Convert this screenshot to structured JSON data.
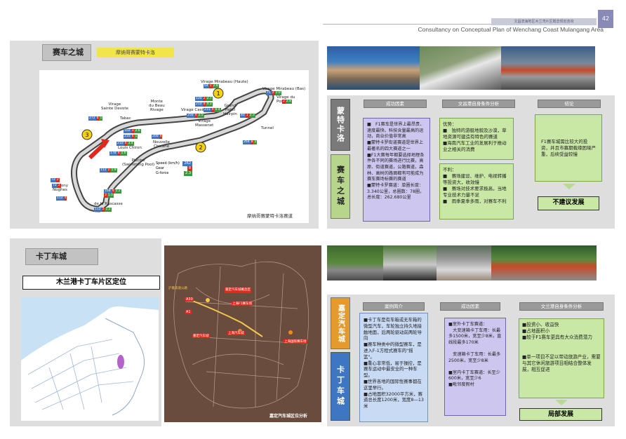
{
  "header": {
    "page_number": "42",
    "small_strip": "文昌滨海地区木兰湾片区概念规划咨询",
    "subtitle": "Consultancy on Conceptual Plan of Wenchang Coast Mulangang Area"
  },
  "section1": {
    "title": "赛车之城",
    "tag": "摩纳哥赛蒙特卡洛",
    "map_caption": "摩纳哥赛蒙特卡洛赛道",
    "track_labels": {
      "mirabeau_haute": "Virage Mirabeau (Haute)",
      "mirabeau_bas": "Virage Mirabeau (Bas)",
      "portier": "Virage du Portier",
      "sainte_devote": "Virage\nSainte Devote",
      "beau_rivage": "Monte\ndu Beau\nRivage",
      "casino": "Virage Casino",
      "grand_hotel": "Grand\nHotel\nHairpin",
      "massenet": "Virage\nMassenet",
      "tabac": "Tabac",
      "louis_chiron": "Louis Chiron",
      "nouvelle_chicane": "Nouvelle\nChicane",
      "tunnel": "Tunnel",
      "piscine": "Piscine\n(Swimming Pool)",
      "anthony_noghes": "Anthony\nNoghes",
      "rascasse": "de la Rascasse"
    },
    "legend": {
      "speed_label": "Speed (km/h)",
      "speed_val": "262",
      "gear_label": "Gear",
      "gear_val": "8",
      "gforce_label": "G-force",
      "gforce_val": "2.3"
    },
    "track_data": [
      {
        "s": "64",
        "g": "1",
        "f": "2.8"
      },
      {
        "s": "71",
        "g": "2",
        "f": "2.0"
      },
      {
        "s": "",
        "g": "2",
        "f": "2.8"
      },
      {
        "s": "120",
        "g": "2",
        "f": "2.7"
      },
      {
        "s": "210",
        "g": "4",
        "f": "4.3"
      },
      {
        "s": "215",
        "g": "4",
        "f": "0.4"
      },
      {
        "s": "256",
        "g": "4",
        "f": "2.5"
      },
      {
        "s": "40",
        "g": "1",
        "f": "2.3"
      },
      {
        "s": "272",
        "g": "6",
        "f": "1"
      },
      {
        "s": "102",
        "g": "3",
        "f": "2.6"
      },
      {
        "s": "210",
        "g": "4",
        "f": "1"
      },
      {
        "s": "264",
        "g": "8",
        "f": "2"
      },
      {
        "s": "210",
        "g": "4",
        "f": "3.4"
      },
      {
        "s": "178",
        "g": "4",
        "f": "1.6"
      },
      {
        "s": "200",
        "g": "4",
        "f": ""
      },
      {
        "s": "112",
        "g": "2",
        "f": "1.9"
      },
      {
        "s": "72",
        "g": "2",
        "f": ""
      },
      {
        "s": "72",
        "g": "2",
        "f": ""
      },
      {
        "s": "168",
        "g": "4",
        "f": "1.2"
      },
      {
        "s": "",
        "g": "3",
        "f": "1.0"
      },
      {
        "s": "112",
        "g": "4",
        "f": ""
      },
      {
        "s": "112",
        "g": "2",
        "f": "1.2"
      }
    ],
    "side_tabs": [
      "蒙特卡洛",
      "赛车之城"
    ],
    "col_heads": [
      "成功因素",
      "文昌港自身条件分析",
      "结论"
    ],
    "success_text": "■　F1赛车是世界上最昂贵、速度最快、科技含量最高的运动，商业价值非常高\n■蒙特卡罗街道赛道是世界上最著名的四大赛道之一\n■F1大赛每年都要选择地理条件各不同的赛场进行比赛，高原、街道赛道，公路赛道，森林、高树的路面都有可能成为赛车赛场标赛的赛道\n■蒙特卡罗赛道：单圈长度：3.340公里，总圈数：78圈，总长度：262.680公里",
    "adv_text": "优势：\n■　独特的游艇地貌及沙漠，草地资源可建造有特色的赛道\n■海南汽车工业的发展利于推动业之相关的消费",
    "disadv_text": "不利：\n■　赛场建设、维护、电视转播等投资大，收效慢\n■　赛场对技术要求极高，当地专业技术力量不足\n■　雨季夏季多雨，对赛车不利",
    "conclusion_text": "F1赛车城需比较大的投资，并且市募期载缘困境严重，后续受益较慢",
    "result": "不建议发展"
  },
  "section2": {
    "title": "卡丁车城",
    "location_title": "木兰港卡丁车片区定位",
    "map_caption": "嘉定汽车城区位分析",
    "map_labels": [
      "沪嘉高速公路",
      "A30",
      "A1",
      "嘉定汽车城概念区",
      "上海F1赛车场",
      "上海汽车城",
      "嘉定汽车城",
      "上海国际赛车场",
      "上海汽车城"
    ],
    "side_tabs": [
      "嘉定汽车城",
      "卡丁车城"
    ],
    "col_heads": [
      "案例简介",
      "成功因素",
      "文兰港自身条件分析"
    ],
    "case_text": "■卡丁车是有车箱或无车箱的微型汽车，车轮独立持久地接触地面，后两轮驱动前两轮导向\n■赛车种类中的微型赛车，是进入F-1方程式赛车的\"摇篮\"。\n■重心非常低，易于操控，是赛车运动中最安全的一种车型。\n■世界各地的国际性赛事都在这里举行。\n■占地面积32000平方米，赛道总长度1200米，宽度8—13米",
    "factor_text": "■室外卡丁车赛道：\n　大变速箱卡丁车用：长最多1500米，宽至少8米，直线段最多170米\n\n　变速箱卡丁车用：长最多2500米，宽至少8米\n\n■室内卡丁车赛道：长至少600米，宽至少6\n■毗邻度假村",
    "self_text": "■投资小、收益快\n■占地面积小\n■较于F1赛车更具有大众消费潜力\n\n\n■单一项目不足以带动旅游产业，需要与其它休闲旅游项目相结合整体发展，相互促进",
    "result": "局部发展"
  },
  "colors": {
    "tab_dark": "#7a7a7a",
    "tab_green": "#b7d68b",
    "tab_orange": "#e59a2e",
    "tab_blue": "#3f76c4",
    "arrow_red": "#e0281c"
  }
}
